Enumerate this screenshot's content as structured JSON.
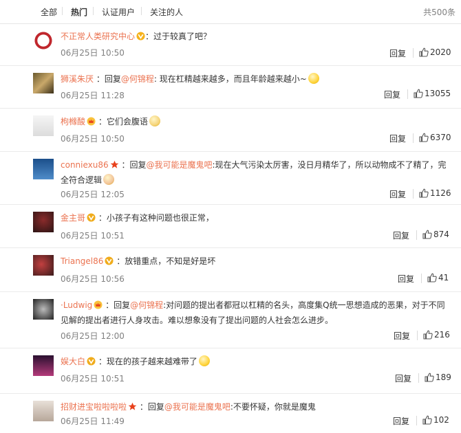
{
  "tabs": [
    "全部",
    "热门",
    "认证用户",
    "关注的人"
  ],
  "active_tab": 1,
  "total": "共500条",
  "reply_label": "回复",
  "comments": [
    {
      "user": "不正常人类研究中心",
      "sep": "：",
      "pre": "",
      "mention": "",
      "text": "过于较真了吧？",
      "time": "06月25日 10:50",
      "likes": "2020",
      "badge": "v-yellow"
    },
    {
      "user": "狮溪朱厌",
      "sep": " ：",
      "pre": "回复",
      "mention": "@何锦程",
      "text": ": 现在杠精越来越多，而且年龄越来越小~",
      "time": "06月25日 11:28",
      "likes": "13055",
      "badge": "",
      "emoji": "laugh"
    },
    {
      "user": "枸橼酸",
      "sep": " ：",
      "pre": "",
      "mention": "",
      "text": "它们会腹语",
      "time": "06月25日 10:50",
      "likes": "6370",
      "badge": "crown",
      "emoji": "cat"
    },
    {
      "user": "conniexu86",
      "sep": " ：",
      "pre": "回复",
      "mention": "@我可能是魔鬼吧",
      "text": ":现在大气污染太厉害，没日月精华了，所以动物成不了精了，完全符合逻辑",
      "time": "06月25日 12:05",
      "likes": "1126",
      "badge": "star",
      "emoji": "victory"
    },
    {
      "user": "金主哥",
      "sep": " ：",
      "pre": "",
      "mention": "",
      "text": "小孩子有这种问题也很正常，",
      "time": "06月25日 10:51",
      "likes": "874",
      "badge": "v-red"
    },
    {
      "user": "Triangel86",
      "sep": " ：",
      "pre": "",
      "mention": "",
      "text": "放错重点，不知是好是坏",
      "time": "06月25日 10:56",
      "likes": "41",
      "badge": "v-red"
    },
    {
      "user": "·Ludwig",
      "sep": " ：",
      "pre": "回复",
      "mention": "@何锦程",
      "text": ":对问题的提出者都冠以杠精的名头，高度集Q统一思想造成的恶果，对于不同见解的提出者进行人身攻击。难以想象没有了提出问题的人社会怎么进步。",
      "time": "06月25日 12:00",
      "likes": "216",
      "badge": "crown"
    },
    {
      "user": "娱大白",
      "sep": " ：",
      "pre": "",
      "mention": "",
      "text": "现在的孩子越来越难带了",
      "time": "06月25日 10:51",
      "likes": "189",
      "badge": "v-red",
      "emoji": "sweat"
    },
    {
      "user": "招财进宝啦啦啦啦",
      "sep": " ：",
      "pre": "回复",
      "mention": "@我可能是魔鬼吧",
      "text": ":不要怀疑，你就是魔鬼",
      "time": "06月25日 11:49",
      "likes": "102",
      "badge": "star"
    }
  ],
  "colors": {
    "username": "#eb7350",
    "text": "#333333",
    "meta": "#808080",
    "divider": "#eaeaea"
  }
}
